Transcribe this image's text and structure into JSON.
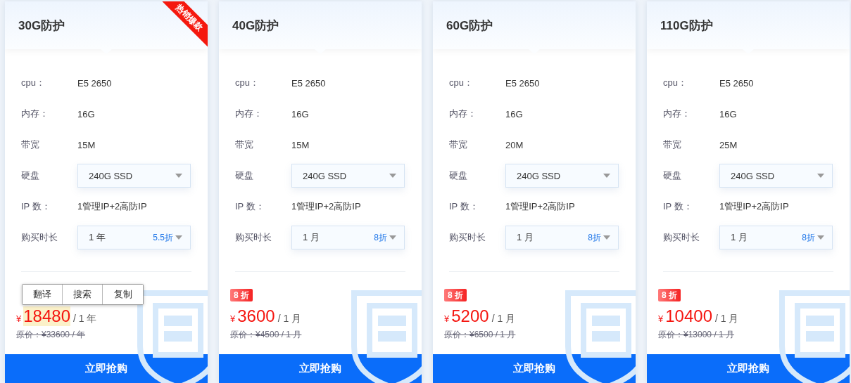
{
  "cards": [
    {
      "title": "30G防护",
      "ribbon": "热销爆款",
      "rows": [
        {
          "kind": "text",
          "label": "cpu：",
          "value": "E5 2650"
        },
        {
          "kind": "text",
          "label": "内存：",
          "value": "16G"
        },
        {
          "kind": "text",
          "label": "带宽",
          "value": "15M"
        },
        {
          "kind": "select",
          "label": "硬盘",
          "value": "240G SSD"
        },
        {
          "kind": "text",
          "label": "IP 数：",
          "value": "1管理IP+2高防IP"
        },
        {
          "kind": "select",
          "label": "购买时长",
          "value": "1 年",
          "discount": "5.5折"
        }
      ],
      "currency": "¥",
      "price": "18480",
      "price_highlighted": true,
      "period": "/ 1 年",
      "original_price": "原价：¥33600 / 年",
      "button": "立即抢购"
    },
    {
      "title": "40G防护",
      "rows": [
        {
          "kind": "text",
          "label": "cpu：",
          "value": "E5 2650"
        },
        {
          "kind": "text",
          "label": "内存：",
          "value": "16G"
        },
        {
          "kind": "text",
          "label": "带宽",
          "value": "15M"
        },
        {
          "kind": "select",
          "label": "硬盘",
          "value": "240G SSD"
        },
        {
          "kind": "text",
          "label": "IP 数：",
          "value": "1管理IP+2高防IP"
        },
        {
          "kind": "select",
          "label": "购买时长",
          "value": "1 月",
          "discount": "8折"
        }
      ],
      "badge": "8 折",
      "currency": "¥",
      "price": "3600",
      "price_highlighted": false,
      "period": "/ 1 月",
      "original_price": "原价：¥4500 / 1 月",
      "button": "立即抢购"
    },
    {
      "title": "60G防护",
      "rows": [
        {
          "kind": "text",
          "label": "cpu：",
          "value": "E5 2650"
        },
        {
          "kind": "text",
          "label": "内存：",
          "value": "16G"
        },
        {
          "kind": "text",
          "label": "带宽",
          "value": "20M"
        },
        {
          "kind": "select",
          "label": "硬盘",
          "value": "240G SSD"
        },
        {
          "kind": "text",
          "label": "IP 数：",
          "value": "1管理IP+2高防IP"
        },
        {
          "kind": "select",
          "label": "购买时长",
          "value": "1 月",
          "discount": "8折"
        }
      ],
      "badge": "8 折",
      "currency": "¥",
      "price": "5200",
      "price_highlighted": false,
      "period": "/ 1 月",
      "original_price": "原价：¥6500 / 1 月",
      "button": "立即抢购"
    },
    {
      "title": "110G防护",
      "rows": [
        {
          "kind": "text",
          "label": "cpu：",
          "value": "E5 2650"
        },
        {
          "kind": "text",
          "label": "内存：",
          "value": "16G"
        },
        {
          "kind": "text",
          "label": "带宽",
          "value": "25M"
        },
        {
          "kind": "select",
          "label": "硬盘",
          "value": "240G SSD"
        },
        {
          "kind": "text",
          "label": "IP 数：",
          "value": "1管理IP+2高防IP"
        },
        {
          "kind": "select",
          "label": "购买时长",
          "value": "1 月",
          "discount": "8折"
        }
      ],
      "badge": "8 折",
      "currency": "¥",
      "price": "10400",
      "price_highlighted": false,
      "period": "/ 1 月",
      "original_price": "原价：¥13000 / 1 月",
      "button": "立即抢购"
    }
  ],
  "context_menu": {
    "items": [
      "翻译",
      "搜索",
      "复制"
    ]
  }
}
